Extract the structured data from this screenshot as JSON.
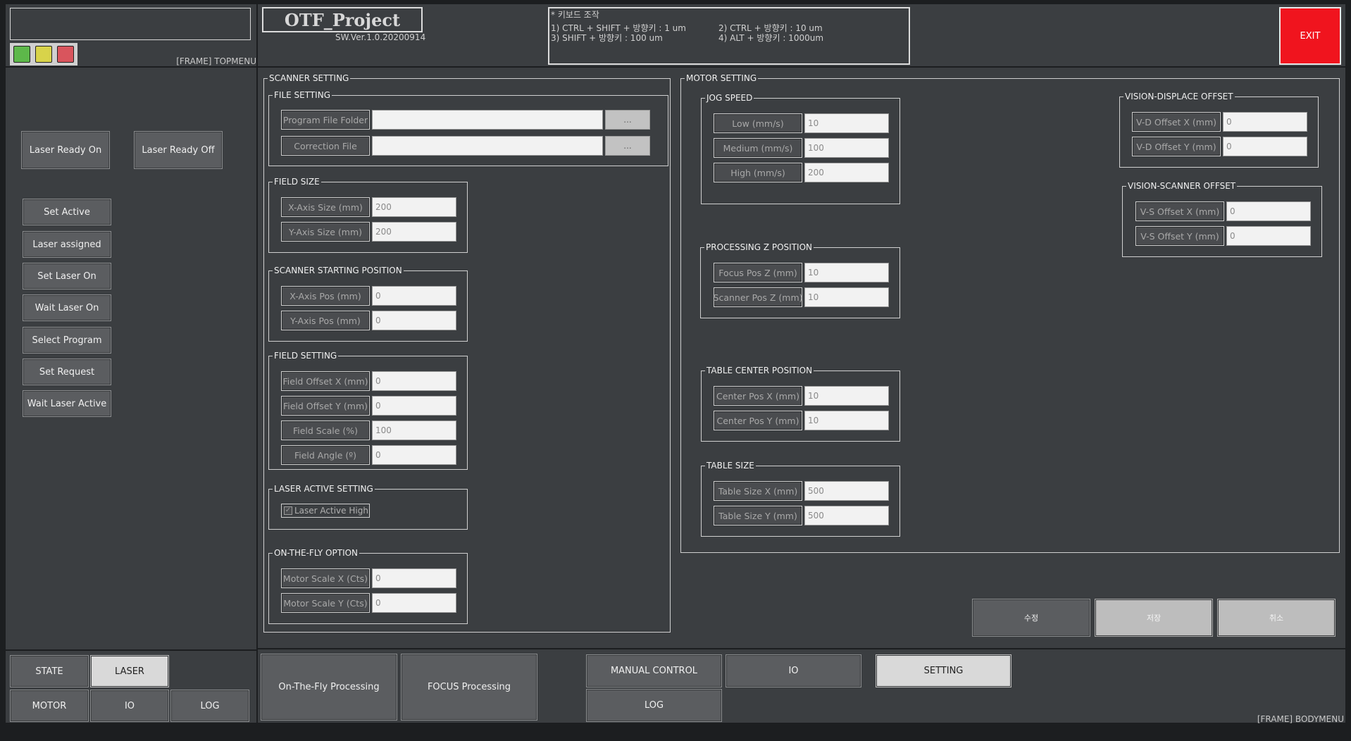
{
  "header": {
    "title": "OTF_Project",
    "version": "SW.Ver.1.0.20200914",
    "topmenu_frame_label": "[FRAME] TOPMENU",
    "exit_label": "EXIT",
    "keyboard_help": {
      "title": "* 키보드 조작",
      "line1_left": "1) CTRL + SHIFT + 방향키 : 1 um",
      "line1_right": "2) CTRL + 방향키 : 10 um",
      "line2_left": "3) SHIFT + 방향키 : 100 um",
      "line2_right": "4) ALT + 방향키 : 1000um"
    },
    "leds": {
      "green": "#5db84a",
      "yellow": "#d8d34a",
      "red": "#d9555d"
    }
  },
  "colors": {
    "exit": "#f0141e",
    "panel": "#3b3e41",
    "background": "#1c1e20"
  },
  "laser_panel": {
    "ready_on": "Laser Ready On",
    "ready_off": "Laser Ready Off",
    "buttons": [
      "Set Active",
      "Laser assigned",
      "Set Laser On",
      "Wait Laser On",
      "Select Program",
      "Set Request",
      "Wait Laser Active"
    ]
  },
  "bottom_left_tabs": {
    "state": "STATE",
    "laser": "LASER",
    "motor": "MOTOR",
    "io": "IO",
    "log": "LOG"
  },
  "scanner_setting": {
    "title": "SCANNER SETTING",
    "file_setting": {
      "title": "FILE SETTING",
      "program_folder_label": "Program File Folder",
      "program_folder_value": "",
      "correction_file_label": "Correction File",
      "correction_file_value": "",
      "browse_label": "..."
    },
    "field_size": {
      "title": "FIELD SIZE",
      "x_label": "X-Axis Size (mm)",
      "x_value": "200",
      "y_label": "Y-Axis Size (mm)",
      "y_value": "200"
    },
    "starting_position": {
      "title": "SCANNER STARTING POSITION",
      "x_label": "X-Axis Pos (mm)",
      "x_value": "0",
      "y_label": "Y-Axis Pos (mm)",
      "y_value": "0"
    },
    "field_setting": {
      "title": "FIELD SETTING",
      "offset_x_label": "Field Offset X (mm)",
      "offset_x_value": "0",
      "offset_y_label": "Field Offset Y (mm)",
      "offset_y_value": "0",
      "scale_label": "Field Scale (%)",
      "scale_value": "100",
      "angle_label": "Field Angle (º)",
      "angle_value": "0"
    },
    "laser_active": {
      "title": "LASER ACTIVE SETTING",
      "checkbox_label": "Laser Active High",
      "checked": true
    },
    "otf_option": {
      "title": "ON-THE-FLY OPTION",
      "motor_x_label": "Motor Scale X (Cts)",
      "motor_x_value": "0",
      "motor_y_label": "Motor Scale Y (Cts)",
      "motor_y_value": "0"
    }
  },
  "motor_setting": {
    "title": "MOTOR SETTING",
    "jog_speed": {
      "title": "JOG SPEED",
      "low_label": "Low (mm/s)",
      "low_value": "10",
      "medium_label": "Medium (mm/s)",
      "medium_value": "100",
      "high_label": "High (mm/s)",
      "high_value": "200"
    },
    "processing_z": {
      "title": "PROCESSING Z POSITION",
      "focus_label": "Focus Pos Z (mm)",
      "focus_value": "10",
      "scanner_label": "Scanner Pos Z (mm)",
      "scanner_value": "10"
    },
    "table_center": {
      "title": "TABLE CENTER POSITION",
      "x_label": "Center Pos X (mm)",
      "x_value": "10",
      "y_label": "Center Pos Y (mm)",
      "y_value": "10"
    },
    "table_size": {
      "title": "TABLE SIZE",
      "x_label": "Table Size X (mm)",
      "x_value": "500",
      "y_label": "Table Size Y (mm)",
      "y_value": "500"
    },
    "vision_displace": {
      "title": "VISION-DISPLACE OFFSET",
      "x_label": "V-D Offset X (mm)",
      "x_value": "0",
      "y_label": "V-D Offset Y (mm)",
      "y_value": "0"
    },
    "vision_scanner": {
      "title": "VISION-SCANNER OFFSET",
      "x_label": "V-S Offset X (mm)",
      "x_value": "0",
      "y_label": "V-S Offset Y (mm)",
      "y_value": "0"
    }
  },
  "actions": {
    "edit": "수정",
    "save": "저장",
    "cancel": "취소"
  },
  "bottom_menu": {
    "otf": "On-The-Fly Processing",
    "focus": "FOCUS Processing",
    "manual": "MANUAL CONTROL",
    "io": "IO",
    "setting": "SETTING",
    "log": "LOG",
    "frame_label": "[FRAME] BODYMENU"
  }
}
